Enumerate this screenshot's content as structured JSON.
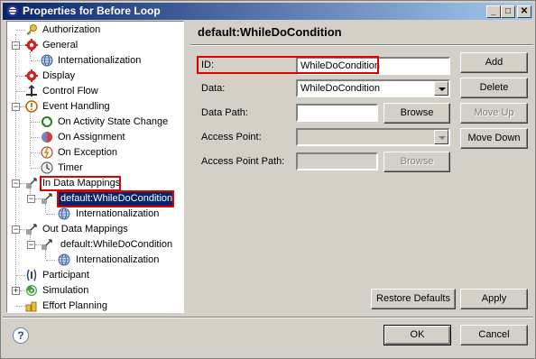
{
  "window": {
    "title": "Properties for Before Loop",
    "controls": {
      "minimize": "_",
      "maximize": "□",
      "close": "✕"
    }
  },
  "tree": {
    "items": [
      {
        "label": "Authorization",
        "icon": "key-icon"
      },
      {
        "label": "General",
        "icon": "gear-icon"
      },
      {
        "label": "Internationalization",
        "icon": "globe-icon"
      },
      {
        "label": "Display",
        "icon": "gear-icon"
      },
      {
        "label": "Control Flow",
        "icon": "control-flow-icon"
      },
      {
        "label": "Event Handling",
        "icon": "warning-icon"
      },
      {
        "label": "On Activity State Change",
        "icon": "state-change-icon"
      },
      {
        "label": "On Assignment",
        "icon": "assignment-icon"
      },
      {
        "label": "On Exception",
        "icon": "exception-icon"
      },
      {
        "label": "Timer",
        "icon": "clock-icon"
      },
      {
        "label": "In Data Mappings",
        "icon": "data-mapping-icon"
      },
      {
        "label": "default:WhileDoCondition",
        "icon": "data-mapping-icon",
        "selected": true
      },
      {
        "label": "Internationalization",
        "icon": "globe-icon"
      },
      {
        "label": "Out Data Mappings",
        "icon": "data-mapping-icon"
      },
      {
        "label": "default:WhileDoCondition",
        "icon": "data-mapping-icon"
      },
      {
        "label": "Internationalization",
        "icon": "globe-icon"
      },
      {
        "label": "Participant",
        "icon": "participant-icon"
      },
      {
        "label": "Simulation",
        "icon": "simulation-icon"
      },
      {
        "label": "Effort Planning",
        "icon": "effort-icon"
      }
    ]
  },
  "page": {
    "title": "default:WhileDoCondition",
    "id_label": "ID:",
    "id_value": "WhileDoCondition",
    "data_label": "Data:",
    "data_value": "WhileDoCondition",
    "data_path_label": "Data Path:",
    "data_path_value": "",
    "access_point_label": "Access Point:",
    "access_point_value": "",
    "access_point_path_label": "Access Point Path:",
    "access_point_path_value": "",
    "browse_label": "Browse",
    "browse2_label": "Browse",
    "add_label": "Add",
    "delete_label": "Delete",
    "move_up_label": "Move Up",
    "move_down_label": "Move Down",
    "restore_defaults_label": "Restore Defaults",
    "apply_label": "Apply"
  },
  "footer": {
    "help_glyph": "?",
    "ok_label": "OK",
    "cancel_label": "Cancel"
  },
  "colors": {
    "highlight_box": "#e00000",
    "selection": "#0a246a",
    "dialog_bg": "#d4d0c8"
  }
}
